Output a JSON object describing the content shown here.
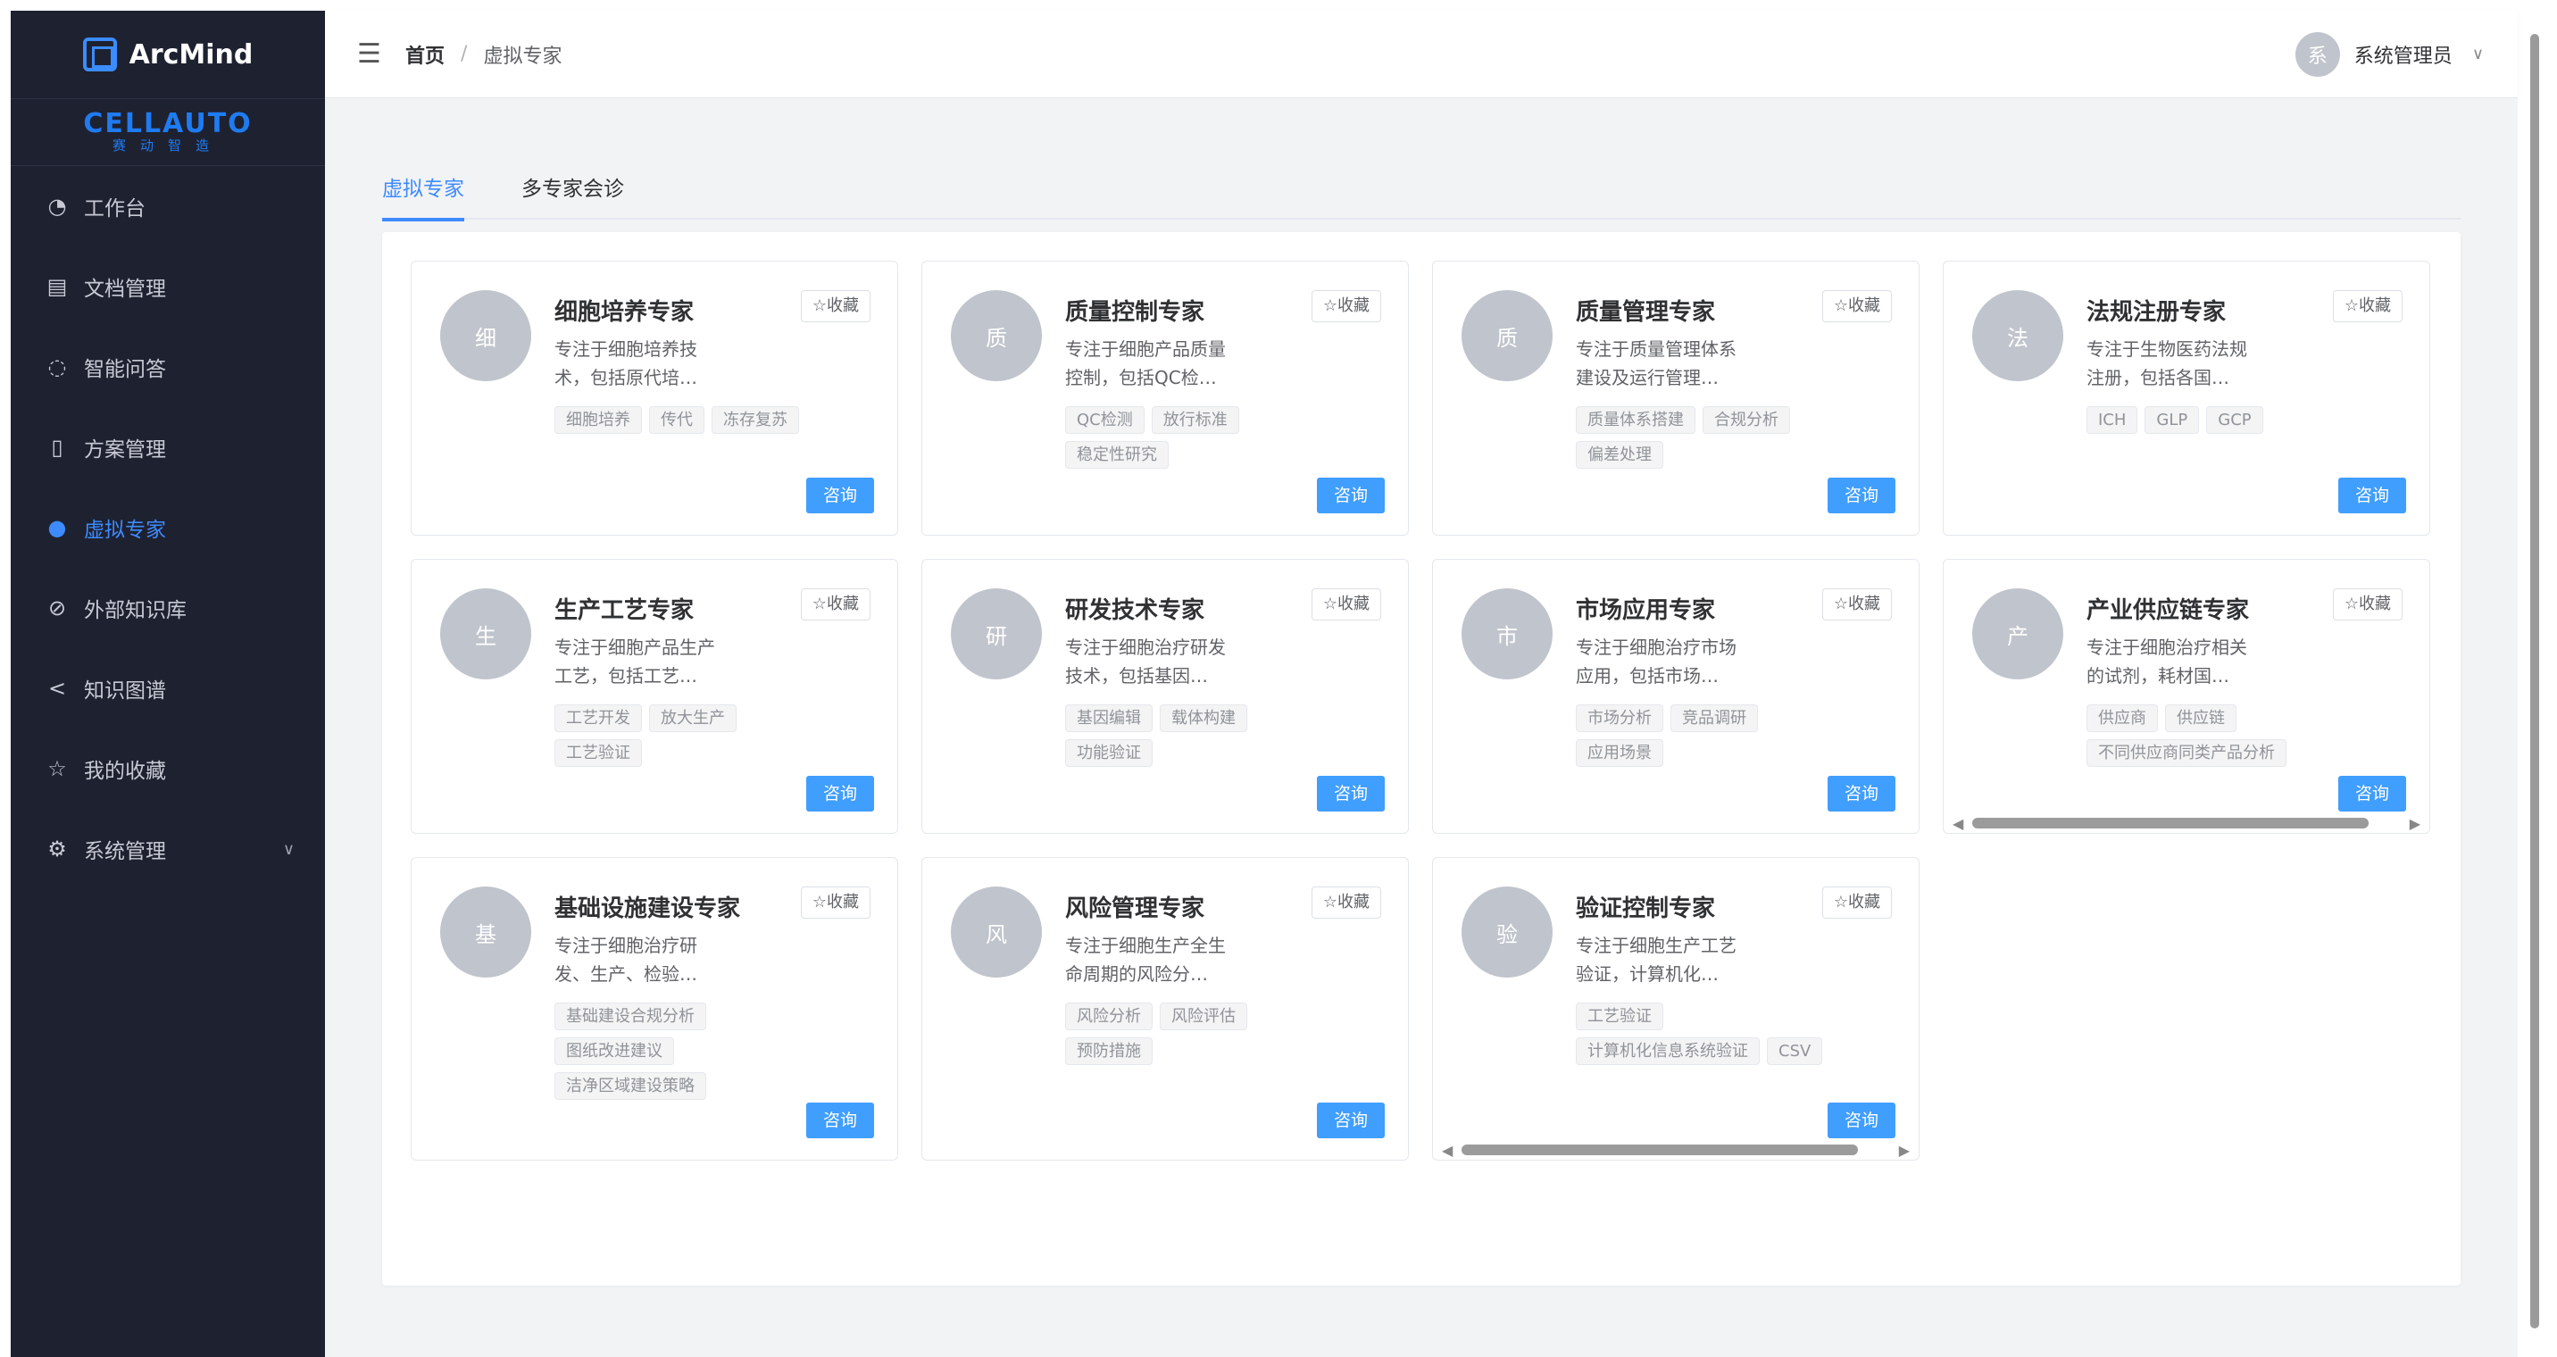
{
  "app": {
    "name": "ArcMind",
    "logo_big": "CELLAUTO",
    "logo_small": "赛动智造"
  },
  "sidebar": {
    "items": [
      {
        "label": "工作台",
        "icon": "dashboard-icon"
      },
      {
        "label": "文档管理",
        "icon": "document-icon"
      },
      {
        "label": "智能问答",
        "icon": "chat-icon"
      },
      {
        "label": "方案管理",
        "icon": "book-icon"
      },
      {
        "label": "虚拟专家",
        "icon": "user-icon",
        "active": true
      },
      {
        "label": "外部知识库",
        "icon": "link-icon"
      },
      {
        "label": "知识图谱",
        "icon": "share-icon"
      },
      {
        "label": "我的收藏",
        "icon": "star-icon"
      },
      {
        "label": "系统管理",
        "icon": "gear-icon"
      }
    ]
  },
  "header": {
    "breadcrumb": {
      "home": "首页",
      "separator": "/",
      "current": "虚拟专家"
    },
    "user": {
      "avatar": "系",
      "name": "系统管理员"
    }
  },
  "tabs": [
    {
      "label": "虚拟专家",
      "active": true
    },
    {
      "label": "多专家会诊",
      "active": false
    }
  ],
  "labels": {
    "favorite": "☆收藏",
    "consult": "咨询"
  },
  "colors": {
    "accent": "#409eff",
    "sidebar_bg": "#1e2130"
  },
  "experts": [
    {
      "avatar": "细",
      "title": "细胞培养专家",
      "desc": [
        "专注于细胞培养技",
        "术，包括原代培…"
      ],
      "tags": [
        "细胞培养",
        "传代",
        "冻存复苏"
      ]
    },
    {
      "avatar": "质",
      "title": "质量控制专家",
      "desc": [
        "专注于细胞产品质量",
        "控制，包括QC检…"
      ],
      "tags": [
        "QC检测",
        "放行标准",
        "稳定性研究"
      ]
    },
    {
      "avatar": "质",
      "title": "质量管理专家",
      "desc": [
        "专注于质量管理体系",
        "建设及运行管理…"
      ],
      "tags": [
        "质量体系搭建",
        "合规分析",
        "偏差处理"
      ]
    },
    {
      "avatar": "法",
      "title": "法规注册专家",
      "desc": [
        "专注于生物医药法规",
        "注册，包括各国…"
      ],
      "tags": [
        "ICH",
        "GLP",
        "GCP"
      ]
    },
    {
      "avatar": "生",
      "title": "生产工艺专家",
      "desc": [
        "专注于细胞产品生产",
        "工艺，包括工艺…"
      ],
      "tags": [
        "工艺开发",
        "放大生产",
        "工艺验证"
      ]
    },
    {
      "avatar": "研",
      "title": "研发技术专家",
      "desc": [
        "专注于细胞治疗研发",
        "技术，包括基因…"
      ],
      "tags": [
        "基因编辑",
        "载体构建",
        "功能验证"
      ]
    },
    {
      "avatar": "市",
      "title": "市场应用专家",
      "desc": [
        "专注于细胞治疗市场",
        "应用，包括市场…"
      ],
      "tags": [
        "市场分析",
        "竞品调研",
        "应用场景"
      ]
    },
    {
      "avatar": "产",
      "title": "产业供应链专家",
      "desc": [
        "专注于细胞治疗相关",
        "的试剂，耗材国…"
      ],
      "tags": [
        "供应商",
        "供应链",
        "不同供应商同类产品分析"
      ],
      "scroll": true
    },
    {
      "avatar": "基",
      "title": "基础设施建设专家",
      "desc": [
        "专注于细胞治疗研",
        "发、生产、检验…"
      ],
      "tags": [
        "基础建设合规分析",
        "图纸改进建议",
        "洁净区域建设策略"
      ]
    },
    {
      "avatar": "风",
      "title": "风险管理专家",
      "desc": [
        "专注于细胞生产全生",
        "命周期的风险分…"
      ],
      "tags": [
        "风险分析",
        "风险评估",
        "预防措施"
      ]
    },
    {
      "avatar": "验",
      "title": "验证控制专家",
      "desc": [
        "专注于细胞生产工艺",
        "验证，计算机化…"
      ],
      "tags": [
        "工艺验证",
        "计算机化信息系统验证",
        "CSV"
      ],
      "scroll": true
    }
  ]
}
